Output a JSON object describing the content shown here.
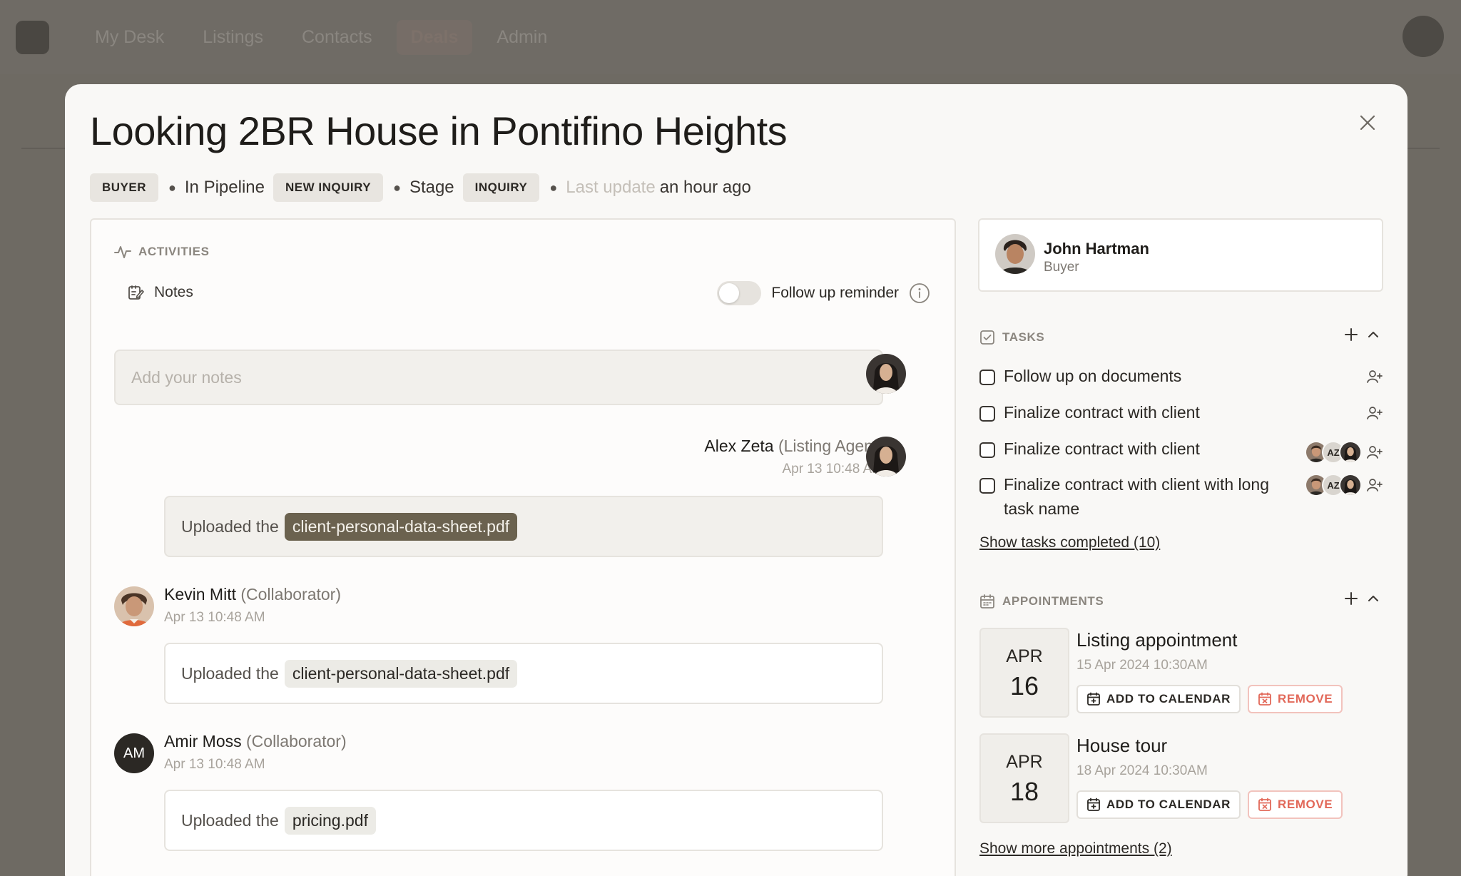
{
  "app": {
    "nav": [
      "My Desk",
      "Listings",
      "Contacts",
      "Deals",
      "Admin"
    ],
    "active_nav": "Deals"
  },
  "deal": {
    "title": "Looking 2BR House in Pontifino Heights",
    "buyer_chip": "BUYER",
    "in_pipeline_label": "In Pipeline",
    "pipeline_chip": "NEW INQUIRY",
    "stage_label": "Stage",
    "stage_chip": "INQUIRY",
    "last_update_label": "Last update",
    "last_update_value": "an hour ago"
  },
  "activities": {
    "heading": "ACTIVITIES",
    "notes_label": "Notes",
    "follow_up_label": "Follow up reminder",
    "notes_placeholder": "Add your notes",
    "entries": [
      {
        "name": "Alex Zeta",
        "role": "(Listing Agent)",
        "time": "Apr 13 10:48 AM",
        "prefix": "Uploaded the",
        "file": "client-personal-data-sheet.pdf"
      },
      {
        "name": "Kevin Mitt",
        "role": "(Collaborator)",
        "time": "Apr 13 10:48 AM",
        "prefix": "Uploaded the",
        "file": "client-personal-data-sheet.pdf"
      },
      {
        "name": "Amir Moss",
        "role": "(Collaborator)",
        "time": "Apr 13 10:48 AM",
        "prefix": "Uploaded the",
        "file": "pricing.pdf",
        "initials": "AM"
      }
    ]
  },
  "client": {
    "name": "John Hartman",
    "role": "Buyer"
  },
  "tasks": {
    "heading": "TASKS",
    "items": [
      {
        "label": "Follow up on documents"
      },
      {
        "label": "Finalize contract with client"
      },
      {
        "label": "Finalize contract with client",
        "assignee_initials": "AZ"
      },
      {
        "label": "Finalize contract with client with long task name",
        "assignee_initials": "AZ"
      }
    ],
    "show_completed": "Show tasks completed (10)"
  },
  "appointments": {
    "heading": "APPOINTMENTS",
    "items": [
      {
        "month": "APR",
        "day": "16",
        "title": "Listing appointment",
        "time": "15 Apr 2024 10:30AM"
      },
      {
        "month": "APR",
        "day": "18",
        "title": "House tour",
        "time": "18 Apr 2024 10:30AM"
      }
    ],
    "add_to_calendar": "ADD TO CALENDAR",
    "remove": "REMOVE",
    "show_more": "Show more appointments (2)"
  },
  "colors": {
    "accent_file_chip": "#6b624f",
    "remove_red": "#e2695a",
    "overlay": "#6e6a63"
  }
}
